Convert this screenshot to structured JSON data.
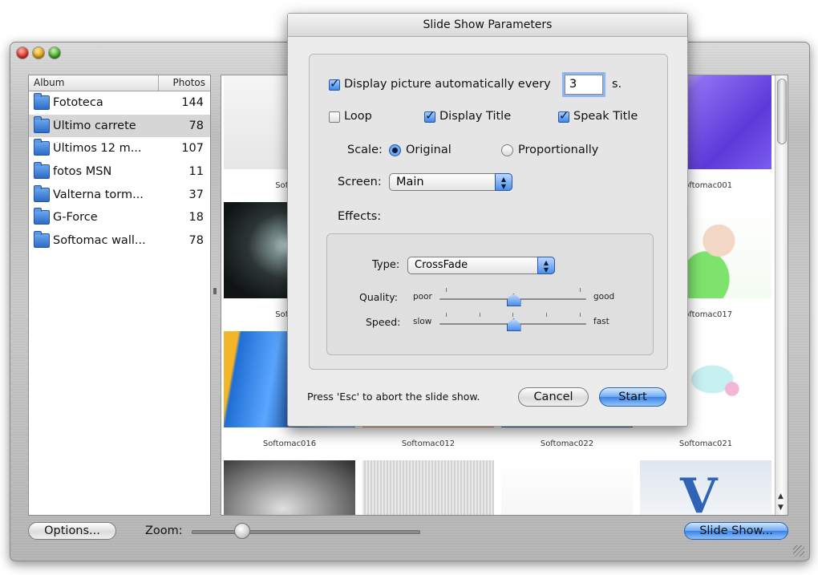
{
  "window": {
    "albums_header": {
      "album": "Album",
      "photos": "Photos"
    },
    "albums": [
      {
        "name": "Fototeca",
        "count": "144",
        "selected": false
      },
      {
        "name": "Último carrete",
        "count": "78",
        "selected": true
      },
      {
        "name": "Últimos 12 m...",
        "count": "107",
        "selected": false
      },
      {
        "name": "fotos MSN",
        "count": "11",
        "selected": false
      },
      {
        "name": "Valterna torm...",
        "count": "37",
        "selected": false
      },
      {
        "name": "G-Force",
        "count": "18",
        "selected": false
      },
      {
        "name": "Softomac wall...",
        "count": "78",
        "selected": false
      }
    ],
    "photos": [
      {
        "caption": "Softom",
        "art": "gray-object"
      },
      {
        "caption": "",
        "art": "blank"
      },
      {
        "caption": "",
        "art": "blank"
      },
      {
        "caption": "Softomac001",
        "art": "purple-apple"
      },
      {
        "caption": "Softom",
        "art": "galaxy"
      },
      {
        "caption": "",
        "art": "blank"
      },
      {
        "caption": "",
        "art": "blank"
      },
      {
        "caption": "Softomac017",
        "art": "anime-girl"
      },
      {
        "caption": "Softomac016",
        "art": "blue-fabric"
      },
      {
        "caption": "Softomac012",
        "art": "orange-figure"
      },
      {
        "caption": "Softomac022",
        "art": "blue-bar"
      },
      {
        "caption": "Softomac021",
        "art": "anime-girl-pink"
      },
      {
        "caption": "",
        "art": "bw-face"
      },
      {
        "caption": "",
        "art": "stripes"
      },
      {
        "caption": "",
        "art": "light-object"
      },
      {
        "caption": "",
        "art": "blue-v"
      }
    ],
    "options_label": "Options...",
    "zoom_label": "Zoom:",
    "zoom_level": 0.22,
    "slideshow_label": "Slide Show..."
  },
  "dialog": {
    "title": "Slide Show Parameters",
    "display_auto_label": "Display picture automatically every",
    "display_auto_checked": true,
    "interval_value": "3",
    "interval_unit": "s.",
    "loop_label": "Loop",
    "loop_checked": false,
    "display_title_label": "Display Title",
    "display_title_checked": true,
    "speak_title_label": "Speak Title",
    "speak_title_checked": true,
    "scale_label": "Scale:",
    "scale_original_label": "Original",
    "scale_proportionally_label": "Proportionally",
    "scale_selected": "Original",
    "screen_label": "Screen:",
    "screen_value": "Main",
    "effects_label": "Effects:",
    "type_label": "Type:",
    "type_value": "CrossFade",
    "quality_label": "Quality:",
    "quality_min": "poor",
    "quality_max": "good",
    "quality_level": 0.5,
    "speed_label": "Speed:",
    "speed_min": "slow",
    "speed_max": "fast",
    "speed_level": 0.5,
    "hint": "Press 'Esc' to abort the slide show.",
    "cancel_label": "Cancel",
    "start_label": "Start"
  },
  "colors": {
    "accent": "#3c86e8",
    "selection": "#d6d6d6"
  }
}
